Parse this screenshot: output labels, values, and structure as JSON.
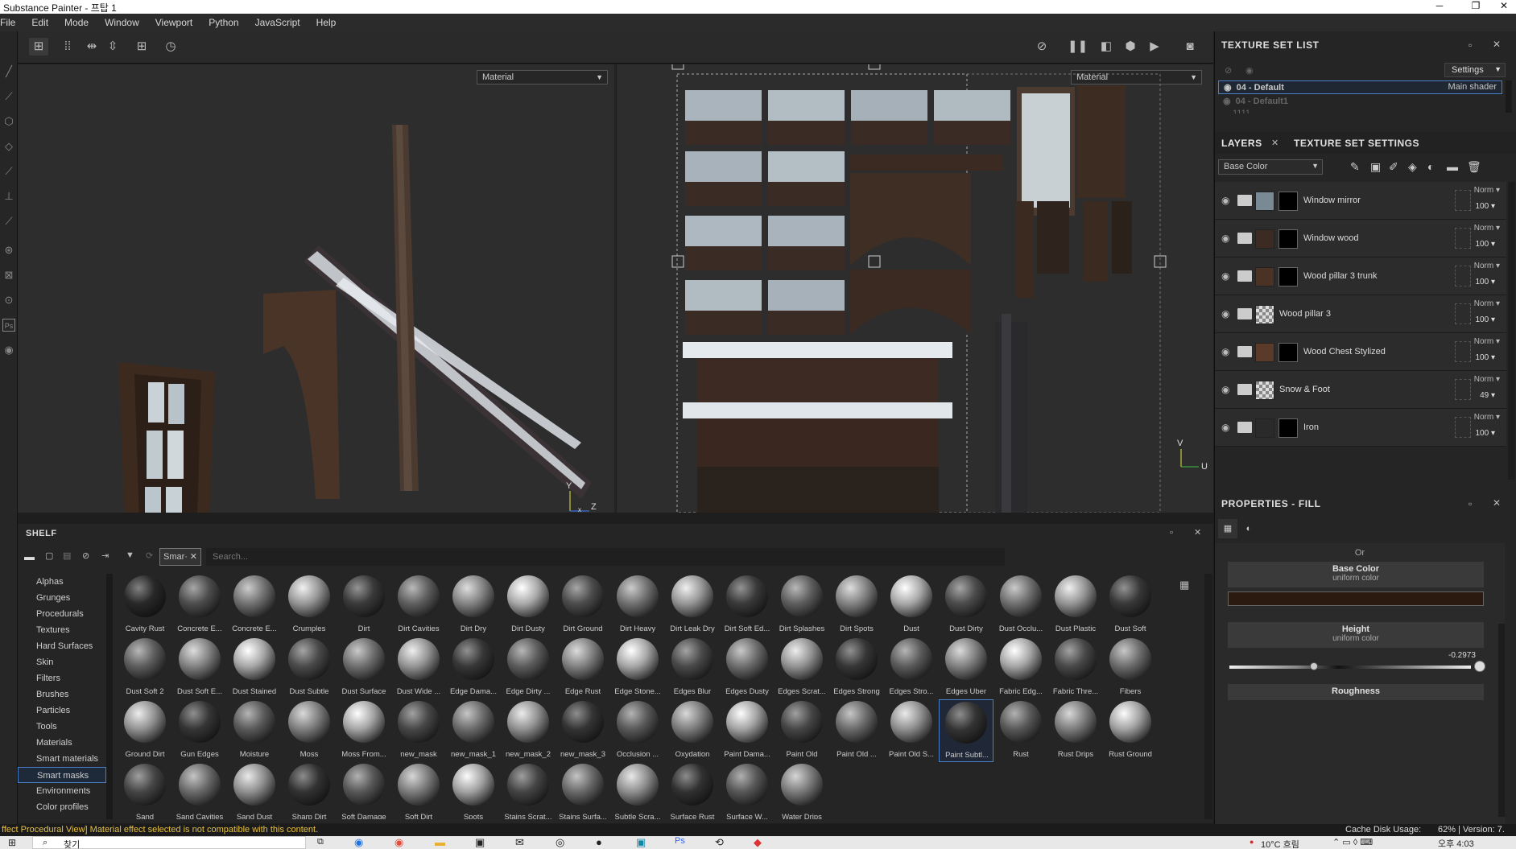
{
  "window": {
    "title": "Substance Painter - 프탑 1",
    "controls": [
      "─",
      "❐",
      "✕"
    ]
  },
  "menu": [
    "File",
    "Edit",
    "Mode",
    "Window",
    "Viewport",
    "Python",
    "JavaScript",
    "Help"
  ],
  "viewport": {
    "left_material": "Material",
    "right_material": "Material",
    "axis_left_y": "Y",
    "axis_left_z": "Z",
    "axis_left_x": "x",
    "axis_right_v": "V",
    "axis_right_u": "U"
  },
  "texture_set_list": {
    "title": "TEXTURE SET LIST",
    "settings_label": "Settings",
    "items": [
      {
        "name": "04 - Default",
        "shader": "Main shader",
        "selected": true
      },
      {
        "name": "04 - Default1",
        "shader": "",
        "selected": false
      },
      {
        "name": "1111",
        "shader": "",
        "selected": false
      }
    ]
  },
  "layers_panel": {
    "tab_layers": "LAYERS",
    "tab_settings": "TEXTURE SET SETTINGS",
    "channel": "Base Color",
    "layers": [
      {
        "name": "Window mirror",
        "blend": "Norm",
        "opacity": "100",
        "thumb": "#7a8a94",
        "mask": "black"
      },
      {
        "name": "Window wood",
        "blend": "Norm",
        "opacity": "100",
        "thumb": "#3b2b22",
        "mask": "black"
      },
      {
        "name": "Wood pillar 3 trunk",
        "blend": "Norm",
        "opacity": "100",
        "thumb": "#4a3224",
        "mask": "black"
      },
      {
        "name": "Wood pillar 3",
        "blend": "Norm",
        "opacity": "100",
        "thumb": "checker",
        "mask": ""
      },
      {
        "name": "Wood Chest Stylized",
        "blend": "Norm",
        "opacity": "100",
        "thumb": "#5a3a28",
        "mask": "black"
      },
      {
        "name": "Snow & Foot",
        "blend": "Norm",
        "opacity": "49",
        "thumb": "checker",
        "mask": ""
      },
      {
        "name": "Iron",
        "blend": "Norm",
        "opacity": "100",
        "thumb": "#2a2a2a",
        "mask": "black"
      }
    ]
  },
  "properties": {
    "title": "PROPERTIES - FILL",
    "or_label": "Or",
    "base_color_label": "Base Color",
    "base_color_sub": "uniform color",
    "base_color_value": "#2b1a10",
    "height_label": "Height",
    "height_sub": "uniform color",
    "height_value": "-0.2973",
    "roughness_label": "Roughness"
  },
  "shelf": {
    "title": "SHELF",
    "filter_tag": "Smar·",
    "search_placeholder": "Search...",
    "categories": [
      "Alphas",
      "Grunges",
      "Procedurals",
      "Textures",
      "Hard Surfaces",
      "Skin",
      "Filters",
      "Brushes",
      "Particles",
      "Tools",
      "Materials",
      "Smart materials",
      "Smart masks",
      "Environments",
      "Color profiles"
    ],
    "selected_category": "Smart masks",
    "items": [
      "Cavity Rust",
      "Concrete E...",
      "Concrete E...",
      "Crumples",
      "Dirt",
      "Dirt Cavities",
      "Dirt Dry",
      "Dirt Dusty",
      "Dirt Ground",
      "Dirt Heavy",
      "Dirt Leak Dry",
      "Dirt Soft Ed...",
      "Dirt Splashes",
      "Dirt Spots",
      "Dust",
      "Dust Dirty",
      "Dust Occlu...",
      "Dust Plastic",
      "Dust Soft",
      "Dust Soft 2",
      "Dust Soft E...",
      "Dust Stained",
      "Dust Subtle",
      "Dust Surface",
      "Dust Wide ...",
      "Edge Dama...",
      "Edge Dirty ...",
      "Edge Rust",
      "Edge Stone...",
      "Edges Blur",
      "Edges Dusty",
      "Edges Scrat...",
      "Edges Strong",
      "Edges Stro...",
      "Edges Uber",
      "Fabric Edg...",
      "Fabric Thre...",
      "Fibers",
      "Ground Dirt",
      "Gun Edges",
      "Moisture",
      "Moss",
      "Moss From...",
      "new_mask",
      "new_mask_1",
      "new_mask_2",
      "new_mask_3",
      "Occlusion ...",
      "Oxydation",
      "Paint Dama...",
      "Paint Old",
      "Paint Old ...",
      "Paint Old S...",
      "Paint Subtl...",
      "Rust",
      "Rust Drips",
      "Rust Ground",
      "Sand",
      "Sand Cavities",
      "Sand Dust",
      "Sharp Dirt",
      "Soft Damage",
      "Soft Dirt",
      "Spots",
      "Stains Scrat...",
      "Stains Surfa...",
      "Subtle Scra...",
      "Surface Rust",
      "Surface W...",
      "Water Drips"
    ],
    "selected_item": "Paint Subtl..."
  },
  "status": {
    "message": "ffect Procedural View] Material effect selected is not compatible with this content.",
    "cache": "Cache Disk Usage:",
    "cache_value": "62%",
    "version": "| Version: 7."
  },
  "taskbar": {
    "search": "찾기",
    "weather": "10°C 흐림",
    "time": "오후 4:03"
  }
}
